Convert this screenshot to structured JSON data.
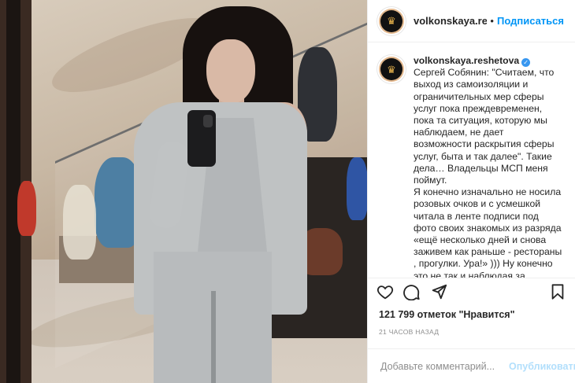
{
  "post": {
    "username": "volkonskaya.reshetova",
    "header_username": "volkonskaya.reshet",
    "follow_label": "Подписаться",
    "header_separator": "•",
    "caption_text": "Сергей Собянин: \"Считаем, что выход из самоизоляции и ограничительных мер сферы услуг пока преждевременен, пока та ситуация, которую мы наблюдаем, не дает возможности раскрытия сферы услуг, быта и так далее\". Такие дела… Владельцы МСП меня поймут.\nЯ конечно изначально не носила розовых очков и с усмешкой читала в ленте подписи под фото своих знакомых из разряда «ещё несколько дней и снова заживем как раньше - рестораны , прогулки. Ура!» ))) Ну конечно это не так и наблюдая за прогрессией роста заболеваемости ждать снятия ограничений в эти дни было очень наивно. Но честно скажу, по мне не",
    "likes": "121 799 отметок \"Нравится\"",
    "time_ago": "21 часов назад",
    "comment_placeholder": "Добавьте комментарий...",
    "publish_label": "Опубликовать"
  },
  "icons": {
    "avatar": "crown-logo",
    "verified": "verified-badge-icon",
    "like": "heart-icon",
    "comment": "comment-bubble-icon",
    "share": "paper-plane-icon",
    "save": "bookmark-icon"
  },
  "colors": {
    "link_blue": "#0095f6",
    "publish_disabled": "#b2dffc",
    "verified_blue": "#3897f0",
    "muted_text": "#8e8e8e",
    "border": "#efefef"
  }
}
